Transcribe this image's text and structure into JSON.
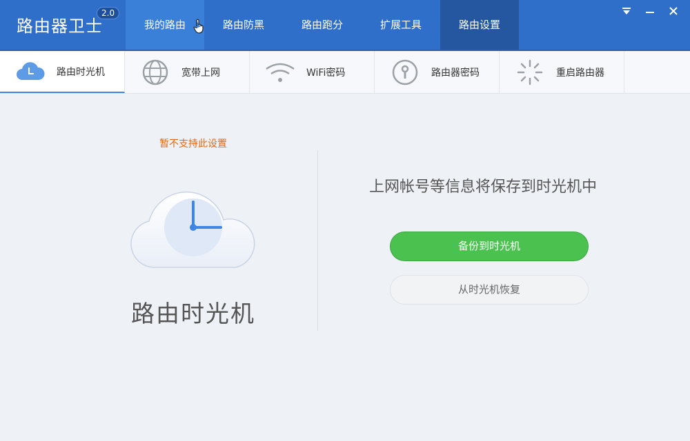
{
  "app": {
    "title": "路由器卫士",
    "version": "2.0"
  },
  "nav": {
    "items": [
      "我的路由",
      "路由防黑",
      "路由跑分",
      "扩展工具",
      "路由设置"
    ]
  },
  "tabs": [
    {
      "label": "路由时光机",
      "icon": "cloud-clock-icon"
    },
    {
      "label": "宽带上网",
      "icon": "globe-icon"
    },
    {
      "label": "WiFi密码",
      "icon": "wifi-icon"
    },
    {
      "label": "路由器密码",
      "icon": "lock-key-icon"
    },
    {
      "label": "重启路由器",
      "icon": "restart-spinner-icon"
    }
  ],
  "main": {
    "warning": "暂不支持此设置",
    "title": "路由时光机",
    "description": "上网帐号等信息将保存到时光机中",
    "backup_button": "备份到时光机",
    "restore_button": "从时光机恢复"
  },
  "colors": {
    "accent": "#2f6fc9",
    "warning": "#e8670f",
    "primary_button": "#4bc14f"
  }
}
